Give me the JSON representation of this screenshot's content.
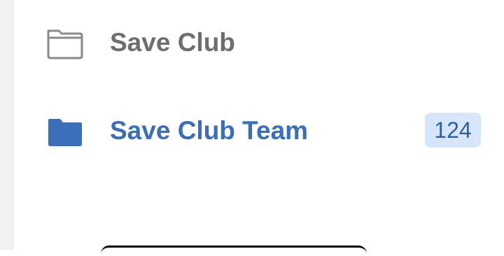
{
  "folders": [
    {
      "label": "Save Club",
      "icon": "folder-outline-icon",
      "selected": false,
      "color": "#6e6e6e",
      "count": null
    },
    {
      "label": "Save Club Team",
      "icon": "folder-filled-icon",
      "selected": true,
      "color": "#3a6fb8",
      "count": "124"
    }
  ],
  "colors": {
    "accent": "#3a6fb8",
    "badge_bg": "#d8e6fb",
    "badge_text": "#2f5f9f",
    "sidebar_bg": "#f0f0f1"
  }
}
